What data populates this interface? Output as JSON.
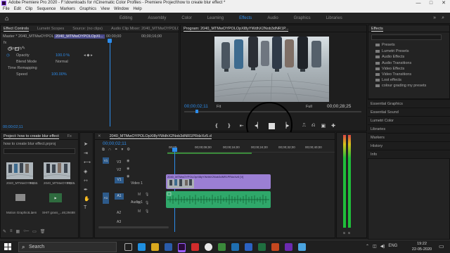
{
  "window": {
    "title": "Adobe Premiere Pro 2020 - F:\\downloads for r\\Cinematic Color Profiles - Premiere Project\\how to create blur effect *",
    "controls": [
      "—",
      "□",
      "✕"
    ]
  },
  "menu": [
    "File",
    "Edit",
    "Clip",
    "Sequence",
    "Markers",
    "Graphics",
    "View",
    "Window",
    "Help"
  ],
  "workspaces": {
    "items": [
      "Editing",
      "Assembly",
      "Color",
      "Learning",
      "Effects",
      "Audio",
      "Graphics",
      "Libraries"
    ],
    "active": "Effects",
    "overflow": "»"
  },
  "effect_controls": {
    "tabs": [
      "Effect Controls",
      "Lumetri Scopes",
      "Source: (no clips)",
      "Audio Clip Mixer: 2040_MTMwOYPOLOp"
    ],
    "clip_selector": "Master * 2040_MTMwOYPOL...",
    "clip_selected": "2040_MTMwOYPOLOpXl...",
    "timecode_start": "00;00;00",
    "timecode_end": "00;00;16;00",
    "section_fx": "fx",
    "opacity_label": "Opacity",
    "opacity_param": "Opacity",
    "opacity_value": "100.0 %",
    "blend_label": "Blend Mode",
    "blend_value": "Normal",
    "time_remap": "Time Remapping",
    "speed_label": "Speed",
    "speed_value": "100.00%",
    "bottom_timecode": "00;00;02;11"
  },
  "program": {
    "title": "Program: 2040_MTMwOYPOLOpXl8yYWdhX2Nob3dNR1P...",
    "timecode": "00;00;02;11",
    "fit": "Fit",
    "quality": "Full",
    "duration": "00;00;28;25"
  },
  "effects_panel": {
    "title": "Effects",
    "search_placeholder": "",
    "items": [
      "Presets",
      "Lumetri Presets",
      "Audio Effects",
      "Audio Transitions",
      "Video Effects",
      "Video Transitions",
      "Lost effects",
      "colour grading my presets"
    ],
    "sections": [
      "Essential Graphics",
      "Essential Sound",
      "Lumetri Color",
      "Libraries",
      "Markers",
      "History",
      "Info"
    ]
  },
  "project": {
    "tabs": [
      "Project: how to create blur effect",
      "Fx"
    ],
    "file": "how to create blur effect.prproj",
    "items": [
      {
        "name": "2040_MTMwOYPOL...",
        "dur": "16;00"
      },
      {
        "name": "2040_MTMwOYPOL...",
        "dur": "28;25"
      },
      {
        "name": "Motion Graphics ...",
        "dur": "1 item"
      },
      {
        "name": "SHIT grass_...",
        "dur": "46;29488"
      }
    ]
  },
  "timeline": {
    "title": "2040_MTMwOYPOLOpXl8yYWdhX2Nob3dNR1PRdzXz5.d",
    "timecode": "00;00;02;11",
    "ruler": [
      "00;00",
      "00;00;08;00",
      "00;00;16;00",
      "00;00;24;00",
      "00;00;32;00",
      "00;00;40;00"
    ],
    "video_tracks": [
      "V3",
      "V2",
      "V1"
    ],
    "audio_tracks": [
      "A1",
      "A2",
      "A3"
    ],
    "track_name_video": "Video 1",
    "track_name_audio": "Audio 1",
    "clip_name": "2040_MTMwOYPOLOpXl8yYWdhX2Nob3dNR1PRdzXz5 [V]",
    "source_v": "V1",
    "source_a": "A1"
  },
  "meter_labels": [
    "S",
    "S"
  ],
  "taskbar": {
    "search_placeholder": "Search",
    "time": "19:22",
    "date": "22-05-2020",
    "lang": "ENG"
  },
  "colors": {
    "accent": "#2d8ceb",
    "video_clip": "#9b7fd4",
    "audio_clip": "#2fa86a"
  }
}
